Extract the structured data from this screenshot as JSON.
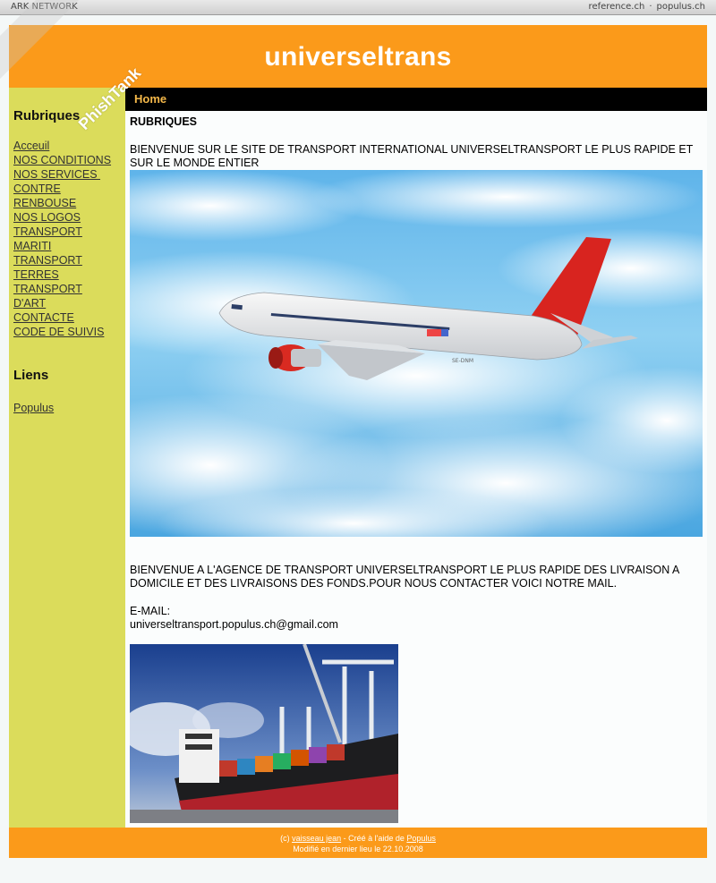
{
  "network_bar": {
    "left_label": "ARK NETWORK",
    "links": [
      "reference.ch",
      "populus.ch"
    ],
    "separator": "·"
  },
  "header": {
    "title": "universeltrans"
  },
  "nav": {
    "home_label": "Home"
  },
  "sidebar": {
    "rubriques_title": "Rubriques",
    "items": [
      {
        "label": "Acceuil"
      },
      {
        "label": "NOS CONDITIONS"
      },
      {
        "label": "NOS SERVICES "
      },
      {
        "label": "CONTRE"
      },
      {
        "label": "RENBOUSE"
      },
      {
        "label": "NOS LOGOS"
      },
      {
        "label": "TRANSPORT"
      },
      {
        "label": "MARITI"
      },
      {
        "label": "TRANSPORT"
      },
      {
        "label": "TERRES"
      },
      {
        "label": "TRANSPORT"
      },
      {
        "label": "D'ART"
      },
      {
        "label": "CONTACTE"
      },
      {
        "label": "CODE DE SUIVIS"
      }
    ],
    "liens_title": "Liens",
    "liens": [
      {
        "label": "Populus"
      }
    ]
  },
  "main": {
    "heading": "RUBRIQUES",
    "welcome": "BIENVENUE SUR LE SITE DE TRANSPORT INTERNATIONAL UNIVERSELTRANSPORT LE PLUS RAPIDE ET SUR LE MONDE ENTIER",
    "agency": "BIENVENUE A L'AGENCE DE TRANSPORT UNIVERSELTRANSPORT LE PLUS RAPIDE DES LIVRAISON A DOMICILE ET DES LIVRAISONS DES FONDS.POUR NOUS CONTACTER VOICI NOTRE MAIL.",
    "email_label": "E-MAIL:",
    "email": "universeltransport.populus.ch@gmail.com",
    "plane_tail_text": "SE-DNM"
  },
  "footer": {
    "prefix": "(c) ",
    "author": "vaisseau jean",
    "created_with": " - Créé à l'aide de ",
    "platform": "Populus",
    "modified": "Modifié en dernier lieu le 22.10.2008"
  },
  "watermark": {
    "text": "PhishTank"
  },
  "colors": {
    "header": "#fb9a1a",
    "sidebar": "#dbdc5b",
    "navbar": "#000000",
    "home_link": "#f4b84a"
  }
}
